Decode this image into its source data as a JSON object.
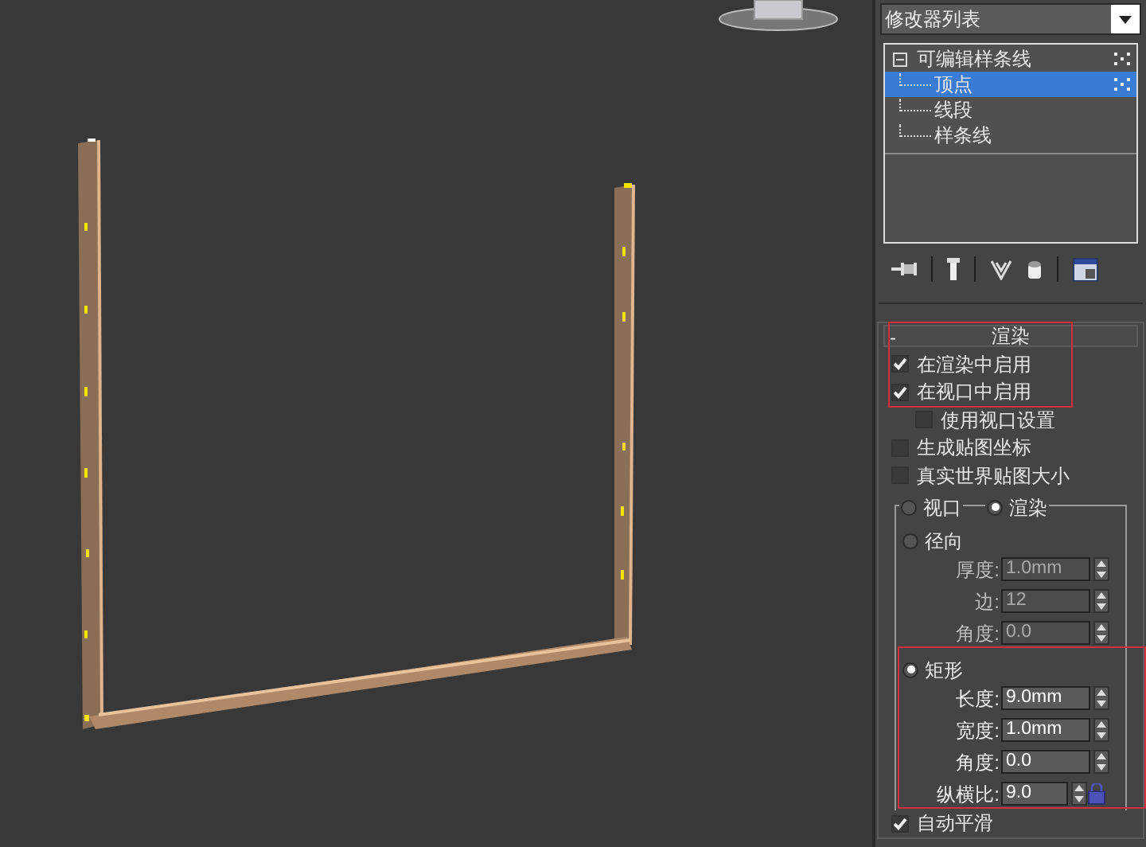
{
  "modifier_list": {
    "label": "修改器列表"
  },
  "stack": [
    {
      "label": "可编辑样条线",
      "expanded": true,
      "selected": false,
      "children": [
        {
          "label": "顶点",
          "selected": true
        },
        {
          "label": "线段",
          "selected": false
        },
        {
          "label": "样条线",
          "selected": false
        }
      ]
    }
  ],
  "rendering": {
    "collapse_symbol": "-",
    "title": "渲染",
    "options": [
      {
        "label": "在渲染中启用",
        "checked": true
      },
      {
        "label": "在视口中启用",
        "checked": true,
        "children": [
          {
            "label": "使用视口设置",
            "checked": false
          }
        ]
      },
      {
        "label": "生成贴图坐标",
        "checked": false
      },
      {
        "label": "真实世界贴图大小",
        "checked": false
      }
    ],
    "mode": [
      {
        "label": "视口",
        "selected": false
      },
      {
        "label": "渲染",
        "selected": true
      }
    ],
    "profiles": [
      {
        "label": "径向",
        "selected": false,
        "fields": [
          {
            "label": "厚度:",
            "value": "1.0mm",
            "kind": "field"
          },
          {
            "label": "边:",
            "value": "12",
            "kind": "field"
          },
          {
            "label": "角度:",
            "value": "0.0",
            "kind": "field"
          }
        ]
      },
      {
        "label": "矩形",
        "selected": true,
        "fields": [
          {
            "label": "长度:",
            "value": "9.0mm",
            "kind": "field"
          },
          {
            "label": "宽度:",
            "value": "1.0mm",
            "kind": "field"
          },
          {
            "label": "角度:",
            "value": "0.0",
            "kind": "field"
          },
          {
            "label": "纵横比:",
            "value": "9.0",
            "kind": "locked"
          }
        ]
      }
    ],
    "auto_smooth": {
      "label": "自动平滑",
      "checked": true
    }
  }
}
